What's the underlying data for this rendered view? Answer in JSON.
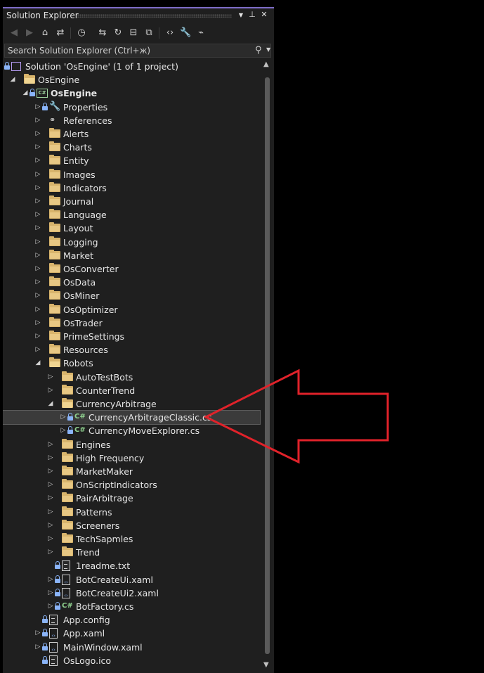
{
  "panel": {
    "title": "Solution Explorer",
    "controls": {
      "dropdown": "▼",
      "pin": "⊥",
      "close": "✕"
    }
  },
  "toolbar": {
    "buttons": [
      {
        "name": "back-icon",
        "glyph": "◀",
        "enabled": false
      },
      {
        "name": "forward-icon",
        "glyph": "▶",
        "enabled": false
      },
      {
        "name": "home-icon",
        "glyph": "⌂",
        "enabled": true
      },
      {
        "name": "vs-sync-icon",
        "glyph": "⇄",
        "enabled": true
      },
      {
        "name": "pending-changes-icon",
        "glyph": "◷",
        "enabled": true
      },
      {
        "name": "switch-views-icon",
        "glyph": "⇆",
        "enabled": true
      },
      {
        "name": "refresh-icon",
        "glyph": "↻",
        "enabled": true
      },
      {
        "name": "collapse-all-icon",
        "glyph": "⊟",
        "enabled": true
      },
      {
        "name": "show-all-files-icon",
        "glyph": "⧉",
        "enabled": true
      },
      {
        "name": "view-code-icon",
        "glyph": "‹›",
        "enabled": true
      },
      {
        "name": "properties-icon",
        "glyph": "🔧",
        "enabled": true
      },
      {
        "name": "preview-icon",
        "glyph": "⌁",
        "enabled": true
      }
    ]
  },
  "search": {
    "placeholder": "Search Solution Explorer (Ctrl+ж)"
  },
  "tree": [
    {
      "label": "Solution 'OsEngine' (1 of 1 project)",
      "level": 0,
      "icon": "solution",
      "expander": "none",
      "lock": true
    },
    {
      "label": "OsEngine",
      "level": 1,
      "icon": "folder-open",
      "expander": "expanded",
      "lock": false
    },
    {
      "label": "OsEngine",
      "level": 2,
      "icon": "project",
      "expander": "expanded",
      "lock": true,
      "bold": true
    },
    {
      "label": "Properties",
      "level": 3,
      "icon": "wrench",
      "expander": "collapsed",
      "lock": true
    },
    {
      "label": "References",
      "level": 3,
      "icon": "references",
      "expander": "collapsed",
      "lock": false
    },
    {
      "label": "Alerts",
      "level": 3,
      "icon": "folder",
      "expander": "collapsed",
      "lock": false
    },
    {
      "label": "Charts",
      "level": 3,
      "icon": "folder",
      "expander": "collapsed",
      "lock": false
    },
    {
      "label": "Entity",
      "level": 3,
      "icon": "folder",
      "expander": "collapsed",
      "lock": false
    },
    {
      "label": "Images",
      "level": 3,
      "icon": "folder",
      "expander": "collapsed",
      "lock": false
    },
    {
      "label": "Indicators",
      "level": 3,
      "icon": "folder",
      "expander": "collapsed",
      "lock": false
    },
    {
      "label": "Journal",
      "level": 3,
      "icon": "folder",
      "expander": "collapsed",
      "lock": false
    },
    {
      "label": "Language",
      "level": 3,
      "icon": "folder",
      "expander": "collapsed",
      "lock": false
    },
    {
      "label": "Layout",
      "level": 3,
      "icon": "folder",
      "expander": "collapsed",
      "lock": false
    },
    {
      "label": "Logging",
      "level": 3,
      "icon": "folder",
      "expander": "collapsed",
      "lock": false
    },
    {
      "label": "Market",
      "level": 3,
      "icon": "folder",
      "expander": "collapsed",
      "lock": false
    },
    {
      "label": "OsConverter",
      "level": 3,
      "icon": "folder",
      "expander": "collapsed",
      "lock": false
    },
    {
      "label": "OsData",
      "level": 3,
      "icon": "folder",
      "expander": "collapsed",
      "lock": false
    },
    {
      "label": "OsMiner",
      "level": 3,
      "icon": "folder",
      "expander": "collapsed",
      "lock": false
    },
    {
      "label": "OsOptimizer",
      "level": 3,
      "icon": "folder",
      "expander": "collapsed",
      "lock": false
    },
    {
      "label": "OsTrader",
      "level": 3,
      "icon": "folder",
      "expander": "collapsed",
      "lock": false
    },
    {
      "label": "PrimeSettings",
      "level": 3,
      "icon": "folder",
      "expander": "collapsed",
      "lock": false
    },
    {
      "label": "Resources",
      "level": 3,
      "icon": "folder",
      "expander": "collapsed",
      "lock": false
    },
    {
      "label": "Robots",
      "level": 3,
      "icon": "folder-open",
      "expander": "expanded",
      "lock": false
    },
    {
      "label": "AutoTestBots",
      "level": 4,
      "icon": "folder",
      "expander": "collapsed",
      "lock": false
    },
    {
      "label": "CounterTrend",
      "level": 4,
      "icon": "folder",
      "expander": "collapsed",
      "lock": false
    },
    {
      "label": "CurrencyArbitrage",
      "level": 4,
      "icon": "folder-open",
      "expander": "expanded",
      "lock": false
    },
    {
      "label": "CurrencyArbitrageClassic.cs",
      "level": 5,
      "icon": "csharp",
      "expander": "collapsed",
      "lock": true,
      "selected": true
    },
    {
      "label": "CurrencyMoveExplorer.cs",
      "level": 5,
      "icon": "csharp",
      "expander": "collapsed",
      "lock": true
    },
    {
      "label": "Engines",
      "level": 4,
      "icon": "folder",
      "expander": "collapsed",
      "lock": false
    },
    {
      "label": "High Frequency",
      "level": 4,
      "icon": "folder",
      "expander": "collapsed",
      "lock": false
    },
    {
      "label": "MarketMaker",
      "level": 4,
      "icon": "folder",
      "expander": "collapsed",
      "lock": false
    },
    {
      "label": "OnScriptIndicators",
      "level": 4,
      "icon": "folder",
      "expander": "collapsed",
      "lock": false
    },
    {
      "label": "PairArbitrage",
      "level": 4,
      "icon": "folder",
      "expander": "collapsed",
      "lock": false
    },
    {
      "label": "Patterns",
      "level": 4,
      "icon": "folder",
      "expander": "collapsed",
      "lock": false
    },
    {
      "label": "Screeners",
      "level": 4,
      "icon": "folder",
      "expander": "collapsed",
      "lock": false
    },
    {
      "label": "TechSapmles",
      "level": 4,
      "icon": "folder",
      "expander": "collapsed",
      "lock": false
    },
    {
      "label": "Trend",
      "level": 4,
      "icon": "folder",
      "expander": "collapsed",
      "lock": false
    },
    {
      "label": "1readme.txt",
      "level": 4,
      "icon": "text",
      "expander": "none",
      "lock": true
    },
    {
      "label": "BotCreateUi.xaml",
      "level": 4,
      "icon": "xaml",
      "expander": "collapsed",
      "lock": true
    },
    {
      "label": "BotCreateUi2.xaml",
      "level": 4,
      "icon": "xaml",
      "expander": "collapsed",
      "lock": true
    },
    {
      "label": "BotFactory.cs",
      "level": 4,
      "icon": "csharp",
      "expander": "collapsed",
      "lock": true
    },
    {
      "label": "App.config",
      "level": 3,
      "icon": "config",
      "expander": "none",
      "lock": true
    },
    {
      "label": "App.xaml",
      "level": 3,
      "icon": "xaml",
      "expander": "collapsed",
      "lock": true
    },
    {
      "label": "MainWindow.xaml",
      "level": 3,
      "icon": "xaml",
      "expander": "collapsed",
      "lock": true
    },
    {
      "label": "OsLogo.ico",
      "level": 3,
      "icon": "image",
      "expander": "none",
      "lock": true
    }
  ],
  "colors": {
    "accent": "#7d6cc7",
    "folder": "#d8b46c",
    "lock": "#8ab4f8",
    "csharp": "#8fd18f",
    "annotation": "#e0222a"
  },
  "annotation": {
    "type": "arrow",
    "points_to": "CurrencyArbitrageClassic.cs"
  }
}
